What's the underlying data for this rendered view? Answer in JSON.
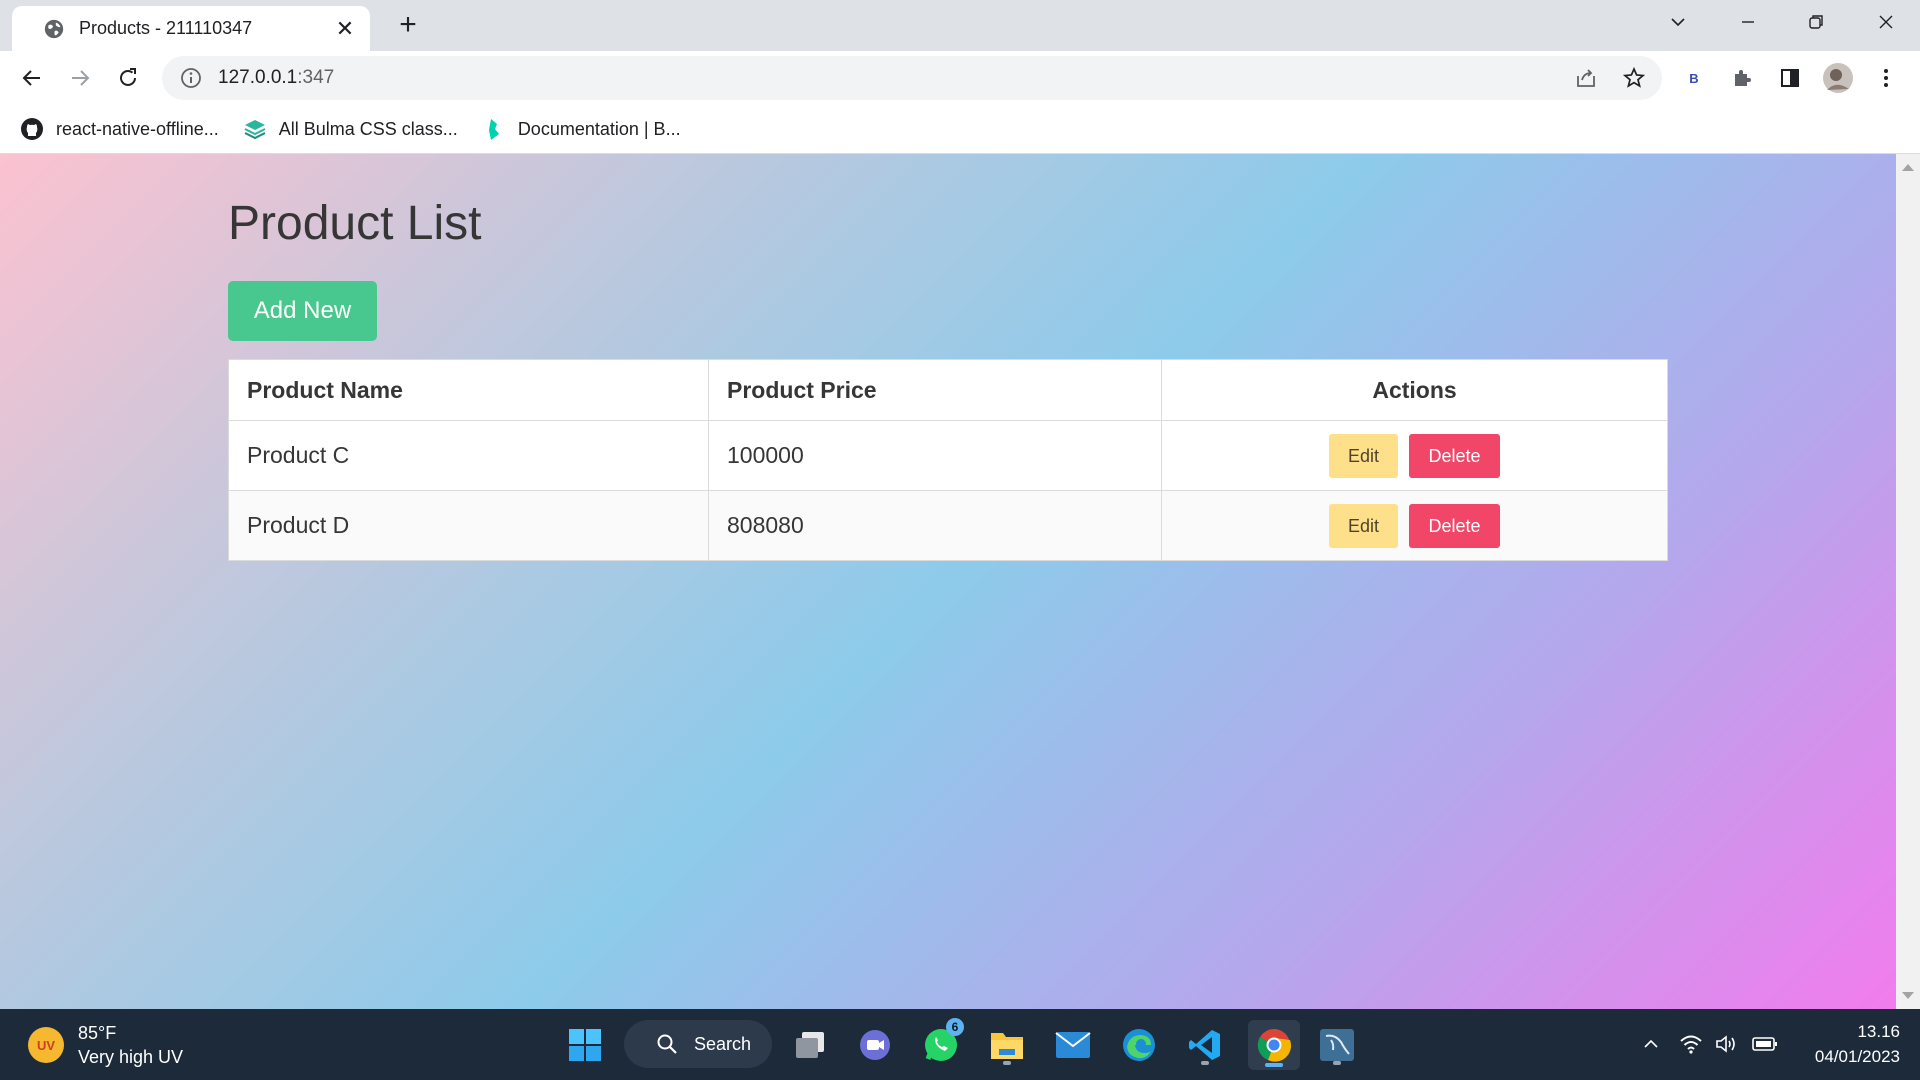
{
  "browser": {
    "tab": {
      "title": "Products - 211110347",
      "icon": "globe-icon",
      "close": "✕"
    },
    "new_tab": "+",
    "address": {
      "host": "127.0.0.1",
      "port": ":347",
      "icon": "info-icon"
    },
    "profile_letter": "B",
    "bookmarks": [
      {
        "label": "react-native-offline...",
        "icon": "github-icon"
      },
      {
        "label": "All Bulma CSS class...",
        "icon": "layers-icon"
      },
      {
        "label": "Documentation | B...",
        "icon": "bulma-icon"
      }
    ]
  },
  "page": {
    "title": "Product List",
    "add_button": "Add New",
    "table": {
      "headers": {
        "name": "Product Name",
        "price": "Product Price",
        "actions": "Actions"
      },
      "rows": [
        {
          "name": "Product C",
          "price": "100000",
          "edit": "Edit",
          "delete": "Delete"
        },
        {
          "name": "Product D",
          "price": "808080",
          "edit": "Edit",
          "delete": "Delete"
        }
      ]
    },
    "colors": {
      "add": "#48c78e",
      "edit": "#ffe08a",
      "delete": "#f14668"
    }
  },
  "taskbar": {
    "weather": {
      "temp": "85°F",
      "desc": "Very high UV",
      "badge": "UV"
    },
    "search_label": "Search",
    "whatsapp_badge": "6",
    "time": "13.16",
    "date": "04/01/2023"
  }
}
